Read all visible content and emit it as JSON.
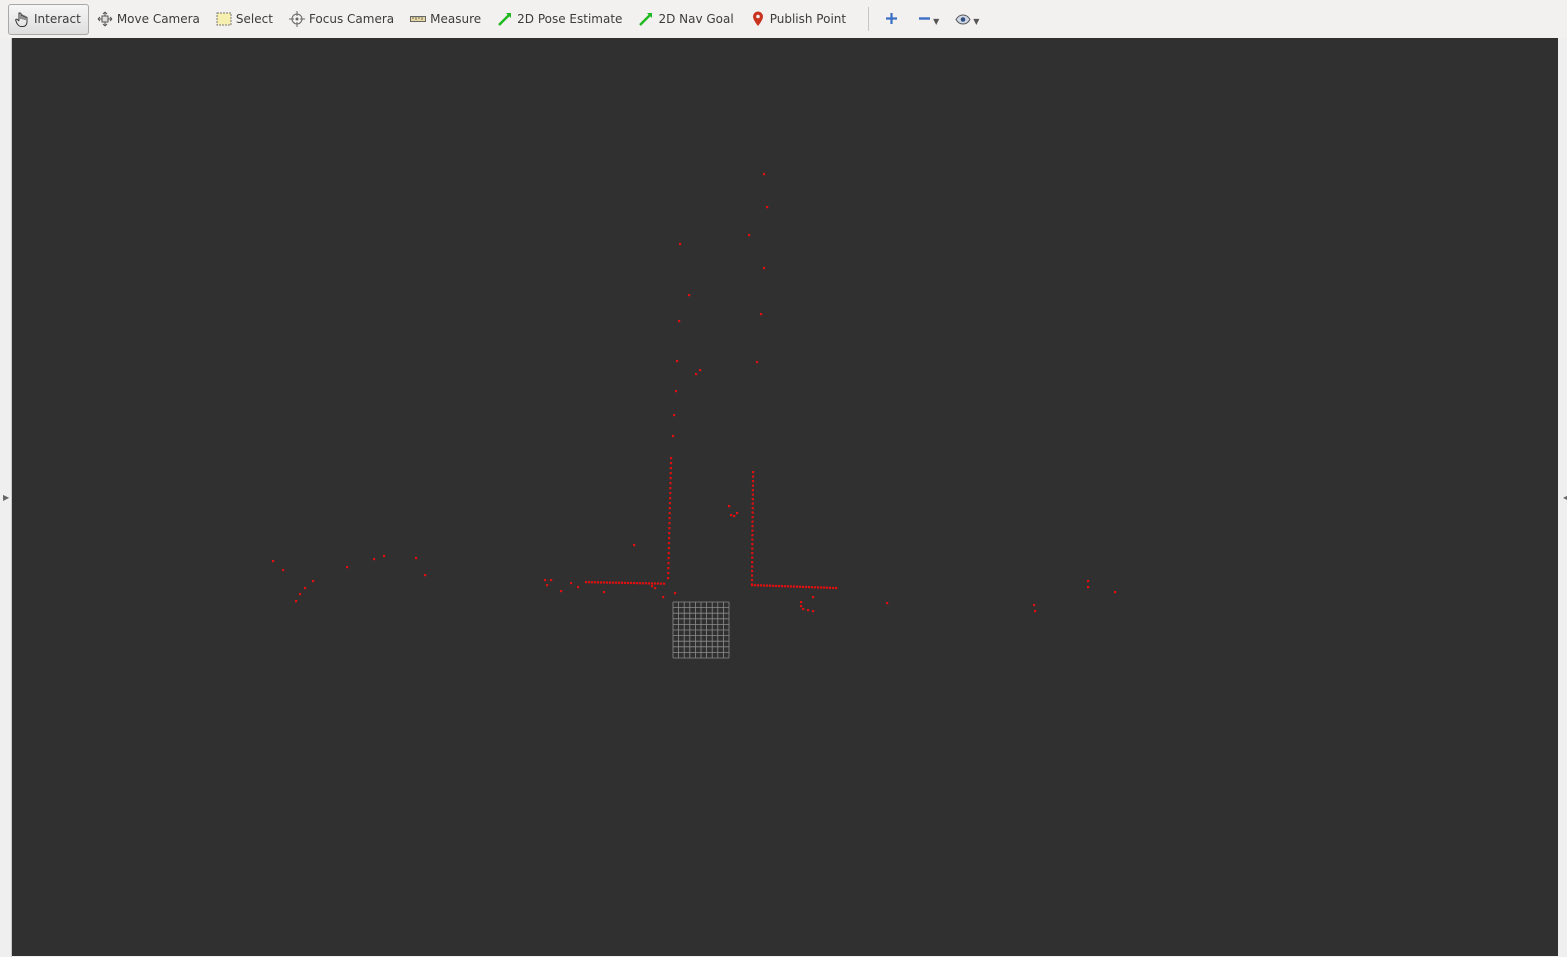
{
  "toolbar": {
    "tools": [
      {
        "label": "Interact",
        "icon": "hand-pointer-icon",
        "active": true
      },
      {
        "label": "Move Camera",
        "icon": "move-camera-icon",
        "active": false
      },
      {
        "label": "Select",
        "icon": "select-rectangle-icon",
        "active": false
      },
      {
        "label": "Focus Camera",
        "icon": "focus-camera-icon",
        "active": false
      },
      {
        "label": "Measure",
        "icon": "ruler-icon",
        "active": false
      },
      {
        "label": "2D Pose Estimate",
        "icon": "green-arrow-icon",
        "active": false
      },
      {
        "label": "2D Nav Goal",
        "icon": "green-arrow-icon",
        "active": false
      },
      {
        "label": "Publish Point",
        "icon": "map-pin-icon",
        "active": false
      }
    ],
    "extra": [
      "add-tool-icon",
      "remove-tool-icon",
      "view-eye-icon"
    ]
  },
  "viewport": {
    "background": "#303030",
    "point_color": "#e01010",
    "grid_color": "#8c8c8c"
  }
}
